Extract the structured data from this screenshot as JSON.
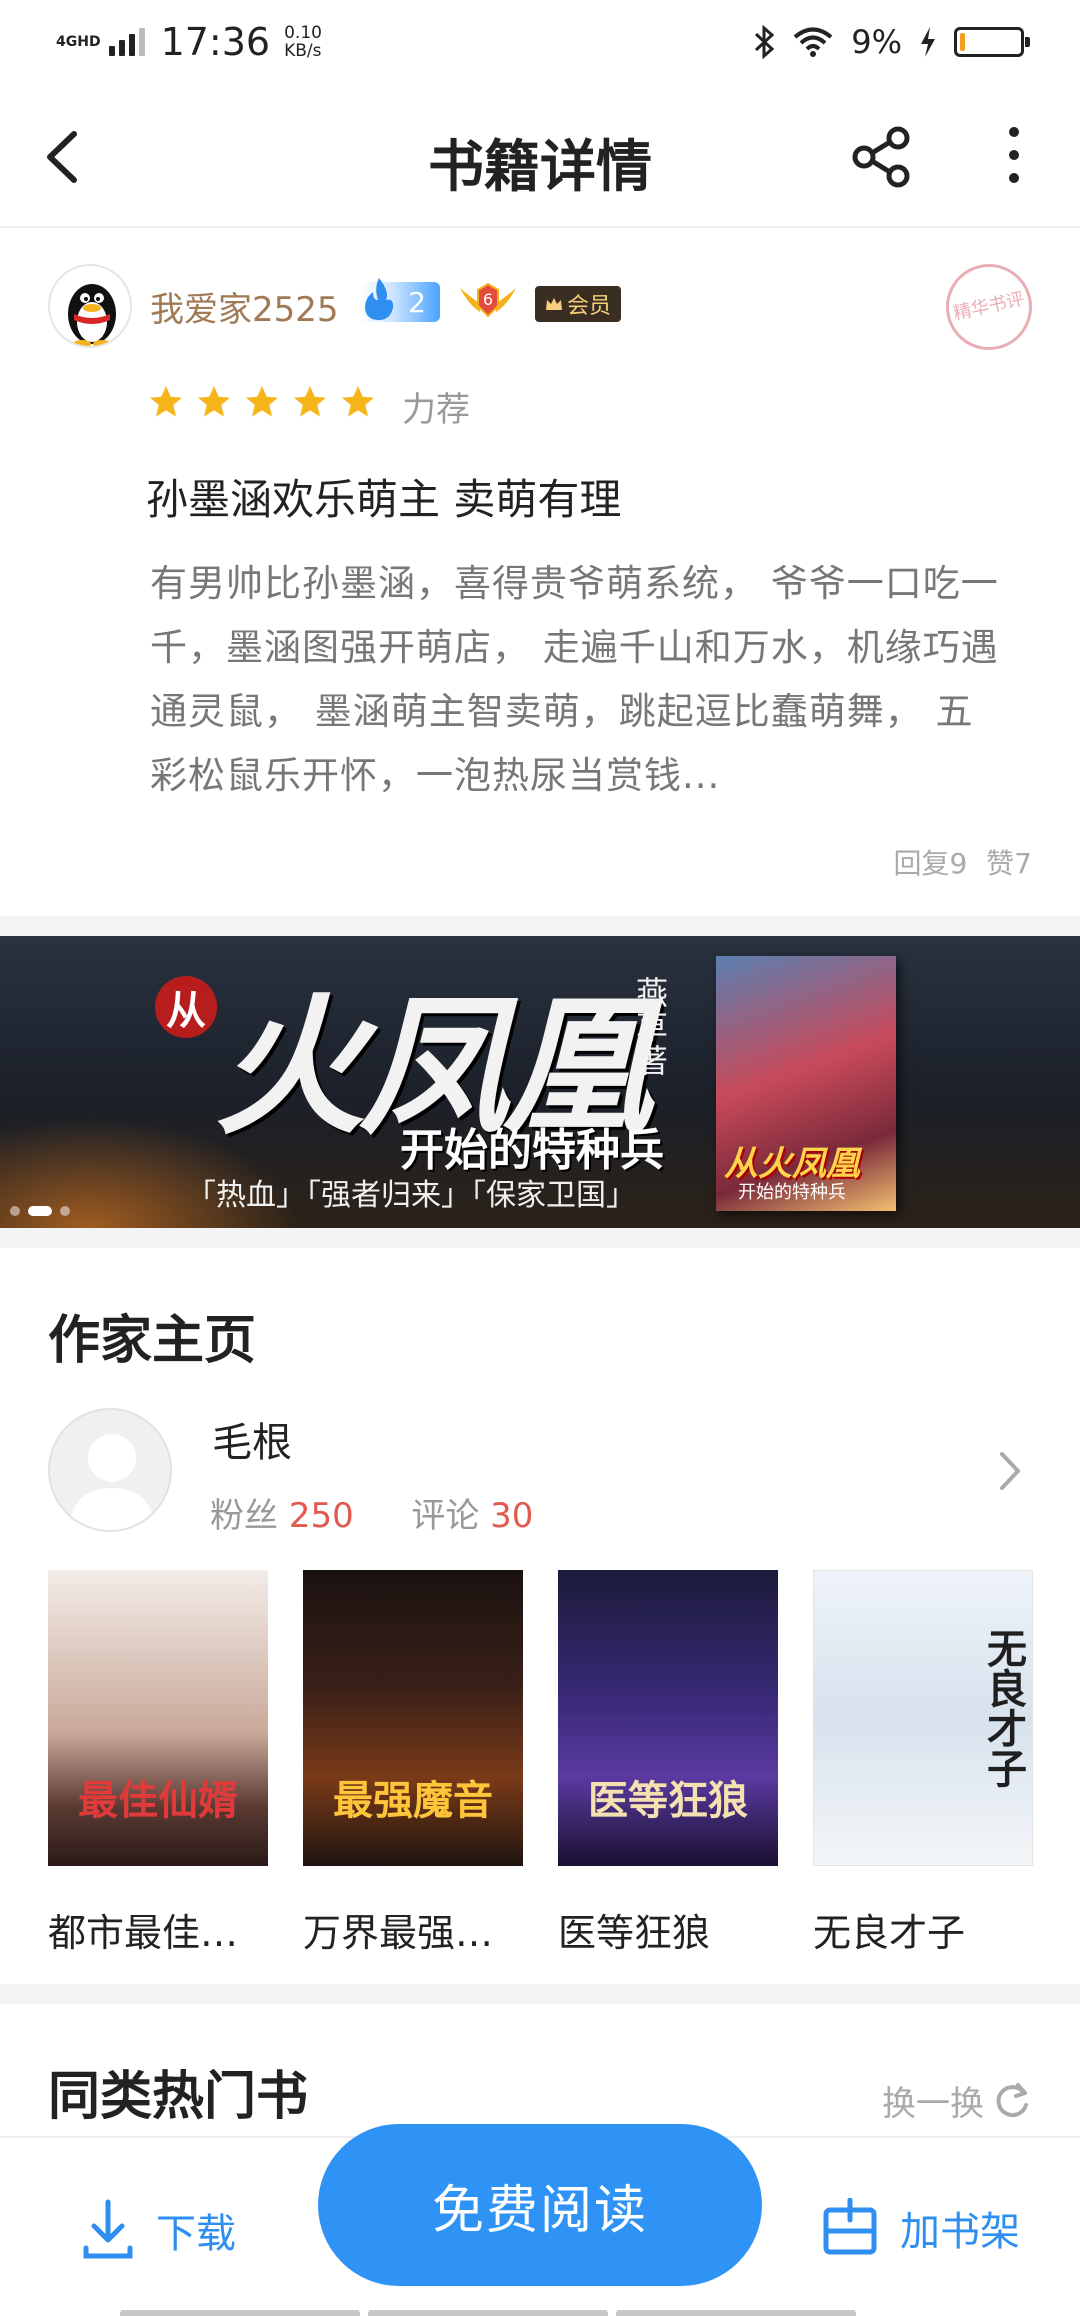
{
  "status_bar": {
    "network": "4GHD",
    "time": "17:36",
    "speed_value": "0.10",
    "speed_unit": "KB/s",
    "battery_text": "9%",
    "battery_level": 0.09
  },
  "nav": {
    "title": "书籍详情"
  },
  "review": {
    "username": "我爱家2525",
    "level": "2",
    "medal_number": "6",
    "vip_label": "会员",
    "stamp_text": "精华书评",
    "rating_stars": 5,
    "rating_label": "力荐",
    "title": "孙墨涵欢乐萌主 卖萌有理",
    "body": "有男帅比孙墨涵，喜得贵爷萌系统， 爷爷一口吃一千，墨涵图强开萌店， 走遍千山和万水，机缘巧遇通灵鼠， 墨涵萌主智卖萌，跳起逗比蠢萌舞， 五彩松鼠乐开怀，一泡热尿当赏钱...",
    "replies": "回复9",
    "likes": "赞7"
  },
  "banner": {
    "prefix": "从",
    "main_title": "火凤凰",
    "author": "燕草著",
    "subtitle": "开始的特种兵",
    "tags": "「热血」「强者归来」「保家卫国」",
    "cover_title": "从火凤凰",
    "cover_subtitle": "开始的特种兵",
    "dots": 3,
    "active_dot": 1
  },
  "author_section": {
    "heading": "作家主页",
    "name": "毛根",
    "fans_label": "粉丝",
    "fans_count": "250",
    "comments_label": "评论",
    "comments_count": "30",
    "books": [
      {
        "name": "都市最佳…",
        "cover_text": "最佳仙婿"
      },
      {
        "name": "万界最强…",
        "cover_text": "最强魔音"
      },
      {
        "name": "医等狂狼",
        "cover_text": "医等狂狼"
      },
      {
        "name": "无良才子",
        "cover_text": "无良才子"
      }
    ]
  },
  "hot_section": {
    "heading": "同类热门书",
    "refresh_label": "换一换"
  },
  "bottom_bar": {
    "download_label": "下载",
    "read_label": "免费阅读",
    "shelf_label": "加书架"
  },
  "colors": {
    "accent_blue": "#2e93f5",
    "stat_red": "#e05a4d",
    "star_gold": "#f7b51c",
    "username_brown": "#a07a55"
  }
}
